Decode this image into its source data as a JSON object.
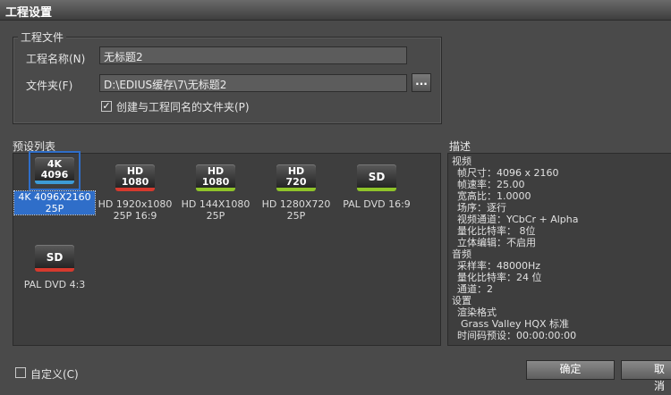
{
  "window": {
    "title": "工程设置"
  },
  "project_file": {
    "legend": "工程文件",
    "name_label": "工程名称(N)",
    "name_value": "无标题2",
    "folder_label": "文件夹(F)",
    "folder_value": "D:\\EDIUS缓存\\7\\无标题2",
    "browse_label": "...",
    "create_folder_label": "创建与工程同名的文件夹(P)",
    "create_folder_checked": true
  },
  "presets": {
    "label": "预设列表",
    "items": [
      {
        "line1": "4K",
        "line2": "4096",
        "stripe": "#3d9bd6",
        "label": "4K 4096X2160 25P",
        "selected": true
      },
      {
        "line1": "HD",
        "line2": "1080",
        "stripe": "#d63a2e",
        "label": "HD 1920x1080 25P 16:9",
        "selected": false
      },
      {
        "line1": "HD",
        "line2": "1080",
        "stripe": "#8fc42a",
        "label": "HD 144X1080 25P",
        "selected": false
      },
      {
        "line1": "HD",
        "line2": "720",
        "stripe": "#8fc42a",
        "label": "HD 1280X720 25P",
        "selected": false
      },
      {
        "line1": "SD",
        "line2": "",
        "stripe": "#8fc42a",
        "label": "PAL DVD 16:9",
        "selected": false
      },
      {
        "line1": "SD",
        "line2": "",
        "stripe": "#d63a2e",
        "label": "PAL DVD 4:3",
        "selected": false
      }
    ]
  },
  "description": {
    "label": "描述",
    "lines": [
      "视频",
      "帧尺寸：4096 x 2160",
      "帧速率：25.00",
      "宽高比：1.0000",
      "场序：逐行",
      "视频通道：YCbCr + Alpha",
      "量化比特率： 8位",
      "立体编辑：不启用",
      "音频",
      "采样率：48000Hz",
      "量化比特率：24 位",
      "通道：2",
      "设置",
      "渲染格式",
      "Grass Valley HQX 标准",
      "时间码预设：00:00:00:00"
    ]
  },
  "custom": {
    "label": "自定义(C)",
    "checked": false
  },
  "buttons": {
    "ok": "确定",
    "cancel": "取消"
  }
}
